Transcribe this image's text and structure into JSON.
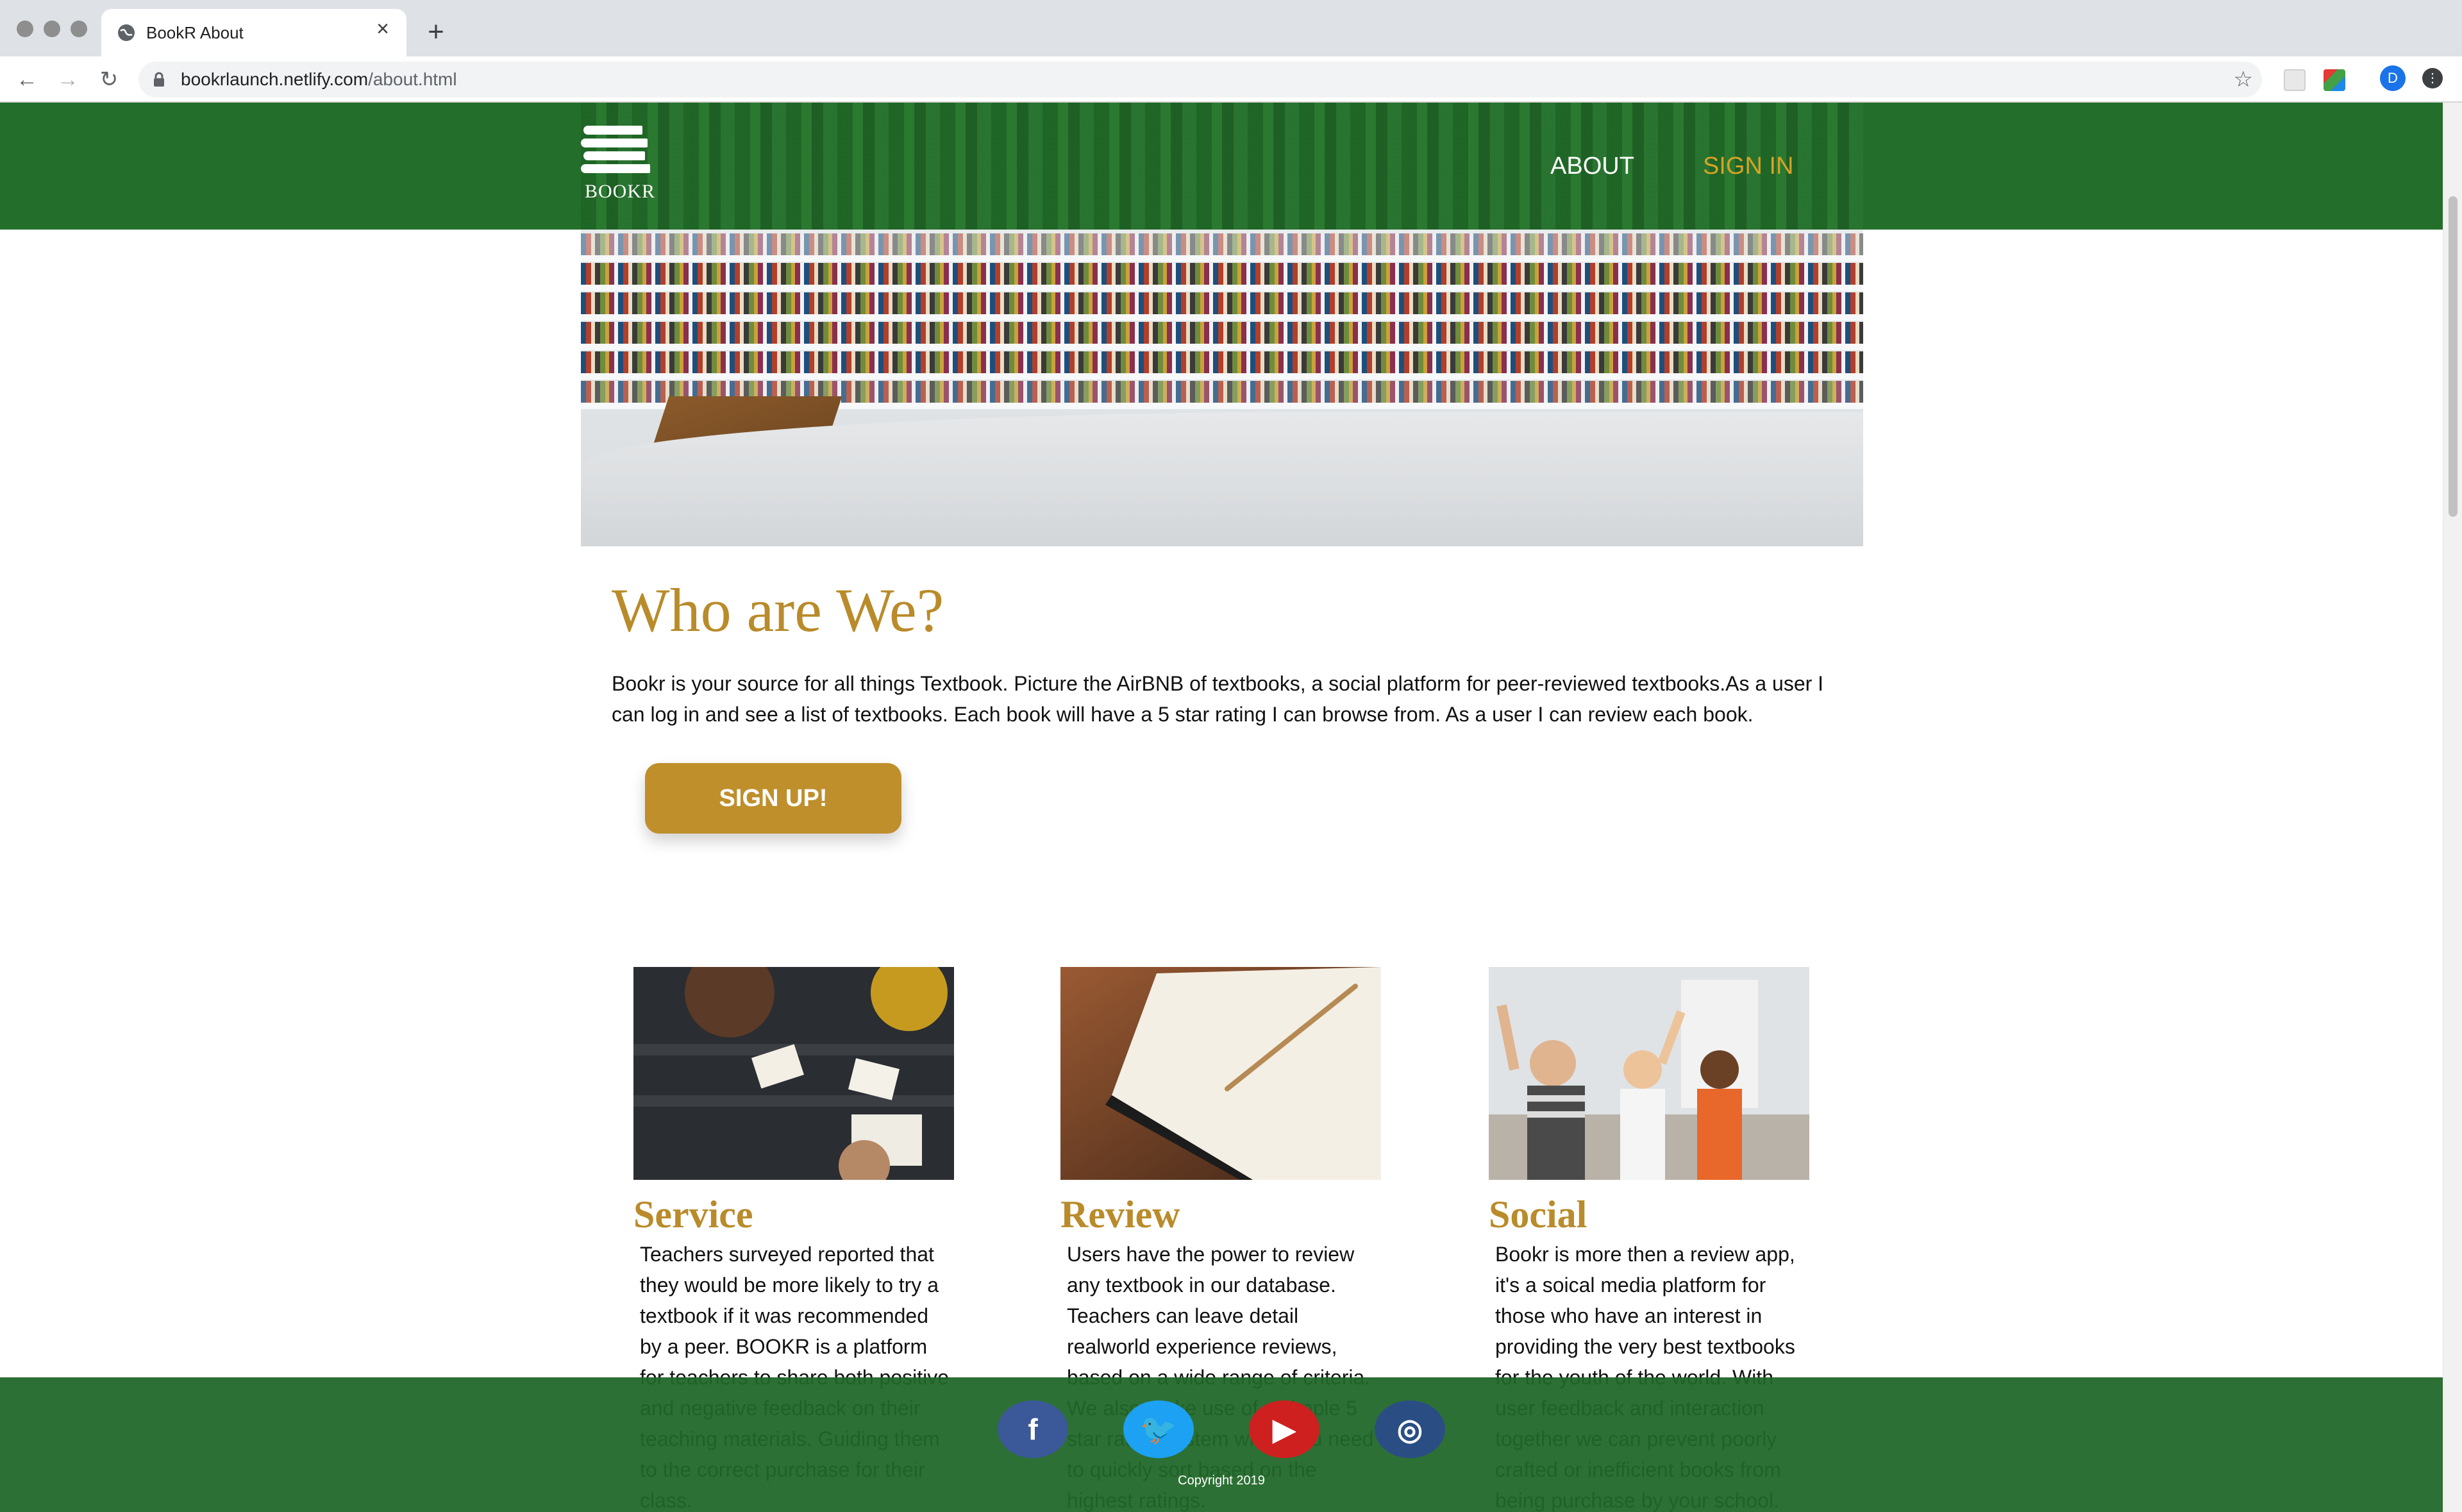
{
  "browser": {
    "tab_title": "BookR About",
    "url_domain": "bookrlaunch.netlify.com",
    "url_path": "/about.html",
    "profile_initial": "D"
  },
  "header": {
    "logo_text": "BOOKR",
    "nav": {
      "about": "ABOUT",
      "sign_in": "SIGN IN"
    }
  },
  "about": {
    "title": "Who are We?",
    "intro": "Bookr is your source for all things Textbook. Picture the AirBNB of textbooks, a social platform for peer-reviewed textbooks.As a user I can log in and see a list of textbooks. Each book will have a 5 star rating I can browse from. As a user I can review each book.",
    "signup_label": "SIGN UP!"
  },
  "features": [
    {
      "title": "Service",
      "text": "Teachers surveyed reported that they would be more likely to try a textbook if it was recommended by a peer. BOOKR is a platform for teachers to share both positive and negative feedback on their teaching materials. Guiding them to the correct purchase for their class."
    },
    {
      "title": "Review",
      "text": "Users have the power to review any textbook in our database. Teachers can leave detail realworld experience reviews, based on a wide range of criteria. We also make use of a simple 5 star rating system when you need to quickly sort based on the highest ratings."
    },
    {
      "title": "Social",
      "text": "Bookr is more then a review app, it's a soical media platform for those who have an interest in providing the very best textbooks for the youth of the world. With user feedback and interaction together we can prevent poorly crafted or inefficient books from being purchase by your school."
    }
  ],
  "footer": {
    "social": [
      {
        "name": "facebook",
        "glyph": "f",
        "color": "#3b5998"
      },
      {
        "name": "twitter",
        "glyph": "🐦",
        "color": "#1da1f2"
      },
      {
        "name": "youtube",
        "glyph": "▶",
        "color": "#cd201f"
      },
      {
        "name": "instagram",
        "glyph": "◎",
        "color": "#2a4e84"
      }
    ],
    "copyright": "Copyright 2019"
  },
  "colors": {
    "brand_green": "#236e2a",
    "accent_gold": "#b98b2a",
    "button_gold": "#bf8f2c"
  }
}
